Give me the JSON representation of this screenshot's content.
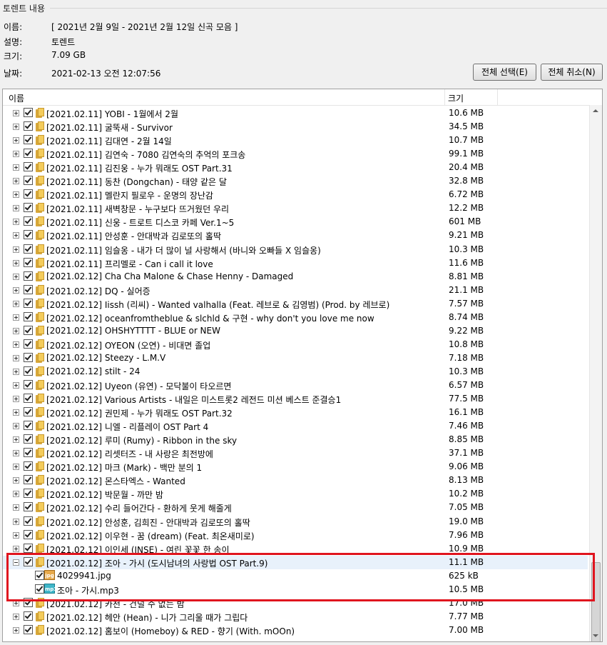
{
  "group_title": "토렌트 내용",
  "info": {
    "name_label": "이름:",
    "name_value": "[ 2021년 2월 9일 - 2021년 2월 12일 신곡 모음 ]",
    "desc_label": "설명:",
    "desc_value": "토렌트",
    "size_label": "크기:",
    "size_value": "7.09 GB",
    "date_label": "날짜:",
    "date_value": "2021-02-13 오전 12:07:56"
  },
  "buttons": {
    "select_all": "전체 선택(E)",
    "deselect_all": "전체 취소(N)"
  },
  "columns": {
    "name": "이름",
    "size": "크기"
  },
  "rows": [
    {
      "name": "[2021.02.11] YOBI - 1월에서 2월",
      "size": "10.6 MB",
      "kind": "folder",
      "expander": "plus"
    },
    {
      "name": "[2021.02.11] 굴뚝새 - Survivor",
      "size": "34.5 MB",
      "kind": "folder",
      "expander": "plus"
    },
    {
      "name": "[2021.02.11] 김대연 - 2월 14일",
      "size": "10.7 MB",
      "kind": "folder",
      "expander": "plus"
    },
    {
      "name": "[2021.02.11] 김연숙 - 7080 김연숙의 추억의 포크송",
      "size": "99.1 MB",
      "kind": "folder",
      "expander": "plus"
    },
    {
      "name": "[2021.02.11] 김진웅 - 누가 뭐래도 OST Part.31",
      "size": "20.4 MB",
      "kind": "folder",
      "expander": "plus"
    },
    {
      "name": "[2021.02.11] 동찬 (Dongchan) - 태양 같은 달",
      "size": "32.8 MB",
      "kind": "folder",
      "expander": "plus"
    },
    {
      "name": "[2021.02.11] 멜란지 필로우 - 운명의 장난감",
      "size": "6.72 MB",
      "kind": "folder",
      "expander": "plus"
    },
    {
      "name": "[2021.02.11] 새벽창문 - 누구보다 뜨거웠던 우리",
      "size": "12.2 MB",
      "kind": "folder",
      "expander": "plus"
    },
    {
      "name": "[2021.02.11] 신웅 - 트로트 디스코 카페 Ver.1~5",
      "size": "601 MB",
      "kind": "folder",
      "expander": "plus"
    },
    {
      "name": "[2021.02.11] 안성훈 - 안대박과 김로또의 홀딱",
      "size": "9.21 MB",
      "kind": "folder",
      "expander": "plus"
    },
    {
      "name": "[2021.02.11] 임슬옹 - 내가 더 많이 널 사랑해서 (바니와 오빠들 X 임슬옹)",
      "size": "10.3 MB",
      "kind": "folder",
      "expander": "plus"
    },
    {
      "name": "[2021.02.11] 프리멜로 - Can i call it love",
      "size": "11.6 MB",
      "kind": "folder",
      "expander": "plus"
    },
    {
      "name": "[2021.02.12] Cha Cha Malone & Chase Henny - Damaged",
      "size": "8.81 MB",
      "kind": "folder",
      "expander": "plus"
    },
    {
      "name": "[2021.02.12] DQ - 실어증",
      "size": "21.1 MB",
      "kind": "folder",
      "expander": "plus"
    },
    {
      "name": "[2021.02.12] Iissh (리씨) - Wanted valhalla (Feat. 레브로 & 김영범) (Prod. by 레브로)",
      "size": "7.57 MB",
      "kind": "folder",
      "expander": "plus"
    },
    {
      "name": "[2021.02.12] oceanfromtheblue & slchld & 구현 - why don't you love me now",
      "size": "8.74 MB",
      "kind": "folder",
      "expander": "plus"
    },
    {
      "name": "[2021.02.12] OHSHYTTTT - BLUE or NEW",
      "size": "9.22 MB",
      "kind": "folder",
      "expander": "plus"
    },
    {
      "name": "[2021.02.12] OYEON (오연) - 비대면 졸업",
      "size": "10.8 MB",
      "kind": "folder",
      "expander": "plus"
    },
    {
      "name": "[2021.02.12] Steezy - L.M.V",
      "size": "7.18 MB",
      "kind": "folder",
      "expander": "plus"
    },
    {
      "name": "[2021.02.12] stilt - 24",
      "size": "10.3 MB",
      "kind": "folder",
      "expander": "plus"
    },
    {
      "name": "[2021.02.12] Uyeon (유연) - 모닥불이 타오르면",
      "size": "6.57 MB",
      "kind": "folder",
      "expander": "plus"
    },
    {
      "name": "[2021.02.12] Various Artists - 내일은 미스트롯2 레전드 미션 베스트 준결승1",
      "size": "77.5 MB",
      "kind": "folder",
      "expander": "plus"
    },
    {
      "name": "[2021.02.12] 권민제 - 누가 뭐래도 OST Part.32",
      "size": "16.1 MB",
      "kind": "folder",
      "expander": "plus"
    },
    {
      "name": "[2021.02.12] 니엘 - 리플레이 OST Part 4",
      "size": "7.46 MB",
      "kind": "folder",
      "expander": "plus"
    },
    {
      "name": "[2021.02.12] 루미 (Rumy) - Ribbon in the sky",
      "size": "8.85 MB",
      "kind": "folder",
      "expander": "plus"
    },
    {
      "name": "[2021.02.12] 리셋터즈 - 내 사랑은 최전방에",
      "size": "37.1 MB",
      "kind": "folder",
      "expander": "plus"
    },
    {
      "name": "[2021.02.12] 마크 (Mark) - 백만 분의 1",
      "size": "9.06 MB",
      "kind": "folder",
      "expander": "plus"
    },
    {
      "name": "[2021.02.12] 몬스타엑스 - Wanted",
      "size": "8.13 MB",
      "kind": "folder",
      "expander": "plus"
    },
    {
      "name": "[2021.02.12] 박문월 - 까만 밤",
      "size": "10.2 MB",
      "kind": "folder",
      "expander": "plus"
    },
    {
      "name": "[2021.02.12] 수리 들어간다 - 환하게 웃게 해줄게",
      "size": "7.05 MB",
      "kind": "folder",
      "expander": "plus"
    },
    {
      "name": "[2021.02.12] 안성훈, 김희진 - 안대박과 김로또의 홀딱",
      "size": "19.0 MB",
      "kind": "folder",
      "expander": "plus"
    },
    {
      "name": "[2021.02.12] 이우현 - 꿈 (dream) (Feat. 최온새미로)",
      "size": "7.96 MB",
      "kind": "folder",
      "expander": "plus"
    },
    {
      "name": "[2021.02.12] 이인세 (INSE) - 여린 꽃꽃 한 송이",
      "size": "10.9 MB",
      "kind": "folder",
      "expander": "plus"
    },
    {
      "name": "[2021.02.12] 조아 - 가시 (도시남녀의 사랑법 OST Part.9)",
      "size": "11.1 MB",
      "kind": "folder",
      "expander": "minus",
      "selected": true
    },
    {
      "name": "4029941.jpg",
      "size": "625 kB",
      "kind": "image",
      "child": true
    },
    {
      "name": "조아 - 가시.mp3",
      "size": "10.5 MB",
      "kind": "mp3",
      "child": true
    },
    {
      "name": "[2021.02.12] 카천 - 건널 수 없는 밤",
      "size": "17.0 MB",
      "kind": "folder",
      "expander": "plus"
    },
    {
      "name": "[2021.02.12] 헤안 (Hean) - 니가 그리울 때가 그립다",
      "size": "7.77 MB",
      "kind": "folder",
      "expander": "plus"
    },
    {
      "name": "[2021.02.12] 홈보이 (Homeboy) & RED - 향기 (With. mOOn)",
      "size": "7.00 MB",
      "kind": "folder",
      "expander": "plus"
    }
  ],
  "icons": {
    "image_label": "jpg",
    "mp3_label": "mp3"
  },
  "highlight_color": "#e0141e"
}
